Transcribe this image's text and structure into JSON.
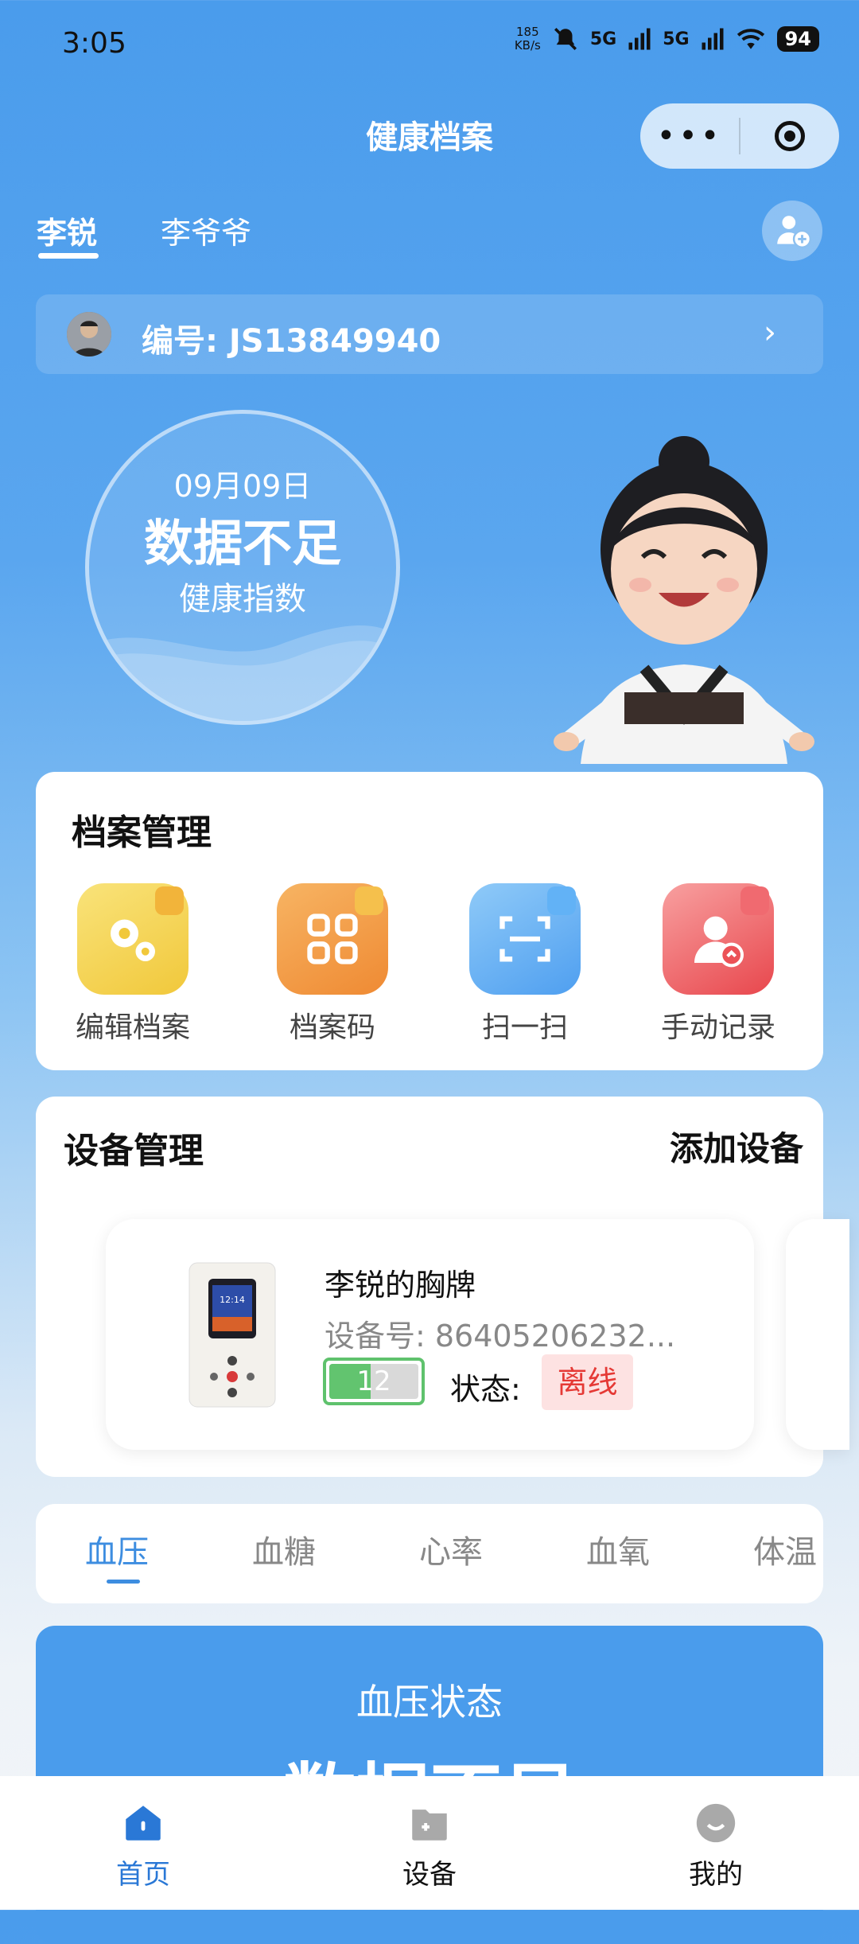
{
  "status": {
    "time": "3:05",
    "speed_top": "185",
    "speed_bottom": "KB/s",
    "net1": "5G",
    "net2": "5G",
    "battery": "94"
  },
  "header": {
    "title": "健康档案"
  },
  "people": {
    "tabs": [
      {
        "label": "李锐"
      },
      {
        "label": "李爷爷"
      }
    ]
  },
  "profile": {
    "id_text": "编号: JS13849940"
  },
  "health": {
    "date": "09月09日",
    "status": "数据不足",
    "label": "健康指数"
  },
  "archive": {
    "title": "档案管理",
    "tools": [
      {
        "label": "编辑档案",
        "icon": "gears-icon",
        "color": "#f3cf45"
      },
      {
        "label": "档案码",
        "icon": "qr-code-icon",
        "color": "#f0963a"
      },
      {
        "label": "扫一扫",
        "icon": "scan-icon",
        "color": "#5aaaf3"
      },
      {
        "label": "手动记录",
        "icon": "user-record-icon",
        "color": "#ec5257"
      }
    ]
  },
  "devices": {
    "title": "设备管理",
    "add_label": "添加设备",
    "items": [
      {
        "name": "李锐的胸牌",
        "number": "设备号: 86405206232...",
        "battery": "12",
        "battery_level": 0.46,
        "state_label": "状态:",
        "state": "离线"
      }
    ]
  },
  "metrics": {
    "tabs": [
      {
        "label": "血压"
      },
      {
        "label": "血糖"
      },
      {
        "label": "心率"
      },
      {
        "label": "血氧"
      },
      {
        "label": "体温"
      }
    ],
    "active": 0
  },
  "bp": {
    "title": "血压状态",
    "value": "数据不足"
  },
  "nav": {
    "items": [
      {
        "label": "首页",
        "icon": "home-icon"
      },
      {
        "label": "设备",
        "icon": "device-icon"
      },
      {
        "label": "我的",
        "icon": "profile-icon"
      }
    ]
  },
  "colors": {
    "primary": "#4a9cec",
    "active_tab": "#3d8de0",
    "offline": "#e53935",
    "battery_green": "#62c46f"
  }
}
